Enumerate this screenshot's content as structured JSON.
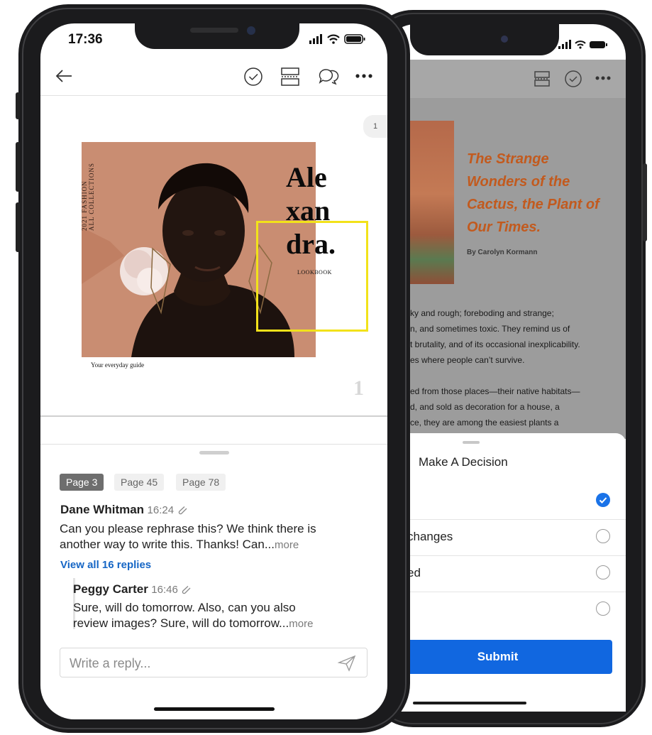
{
  "front": {
    "status": {
      "time": "17:36"
    },
    "doc": {
      "page_marker": "1",
      "side_text_line1": "2021 FASHION",
      "side_text_line2": "ALL COLLECTIONS",
      "title_line1": "Ale",
      "title_line2": "xan",
      "title_line3": "dra.",
      "subtitle": "LOOKBOOK",
      "caption": "Your everyday guide",
      "page_number": "1"
    },
    "tabs": [
      {
        "label": "Page 3",
        "active": true
      },
      {
        "label": "Page 45",
        "active": false
      },
      {
        "label": "Page 78",
        "active": false
      }
    ],
    "comment": {
      "author": "Dane Whitman",
      "time": "16:24",
      "line1": "Can you please rephrase this? We think there is",
      "line2": "another way to write this. Thanks! Can...",
      "more": "more"
    },
    "view_all": "View all 16 replies",
    "reply": {
      "author": "Peggy Carter",
      "time": "16:46",
      "line1": "Sure, will do tomorrow. Also, can you also",
      "line2": "review images? Sure, will do tomorrow...",
      "more": "more"
    },
    "reply_input": {
      "placeholder": "Write a reply..."
    }
  },
  "back": {
    "article": {
      "title": "The Strange Wonders of the Cactus, the Plant of Our Times.",
      "byline": "By Carolyn Kormann",
      "paragraph1": [
        "ky and rough; foreboding and strange;",
        "n, and sometimes toxic. They remind us of",
        "t brutality, and of its occasional inexplicability.",
        "es where people can’t survive."
      ],
      "paragraph2": [
        "ed from those places—their native habitats—",
        "d, and sold as decoration for a house, a",
        "ce, they are among the easiest plants a"
      ]
    },
    "sheet": {
      "title": "Make A Decision",
      "options": [
        {
          "label": "",
          "checked": true
        },
        {
          "label": "changes",
          "checked": false
        },
        {
          "label": "ed",
          "checked": false
        },
        {
          "label": "",
          "checked": false
        }
      ],
      "submit": "Submit"
    }
  },
  "colors": {
    "accent_blue": "#1167e0",
    "link_blue": "#1666c5",
    "highlight_yellow": "#f2e21a",
    "article_orange": "#c25a1e"
  }
}
